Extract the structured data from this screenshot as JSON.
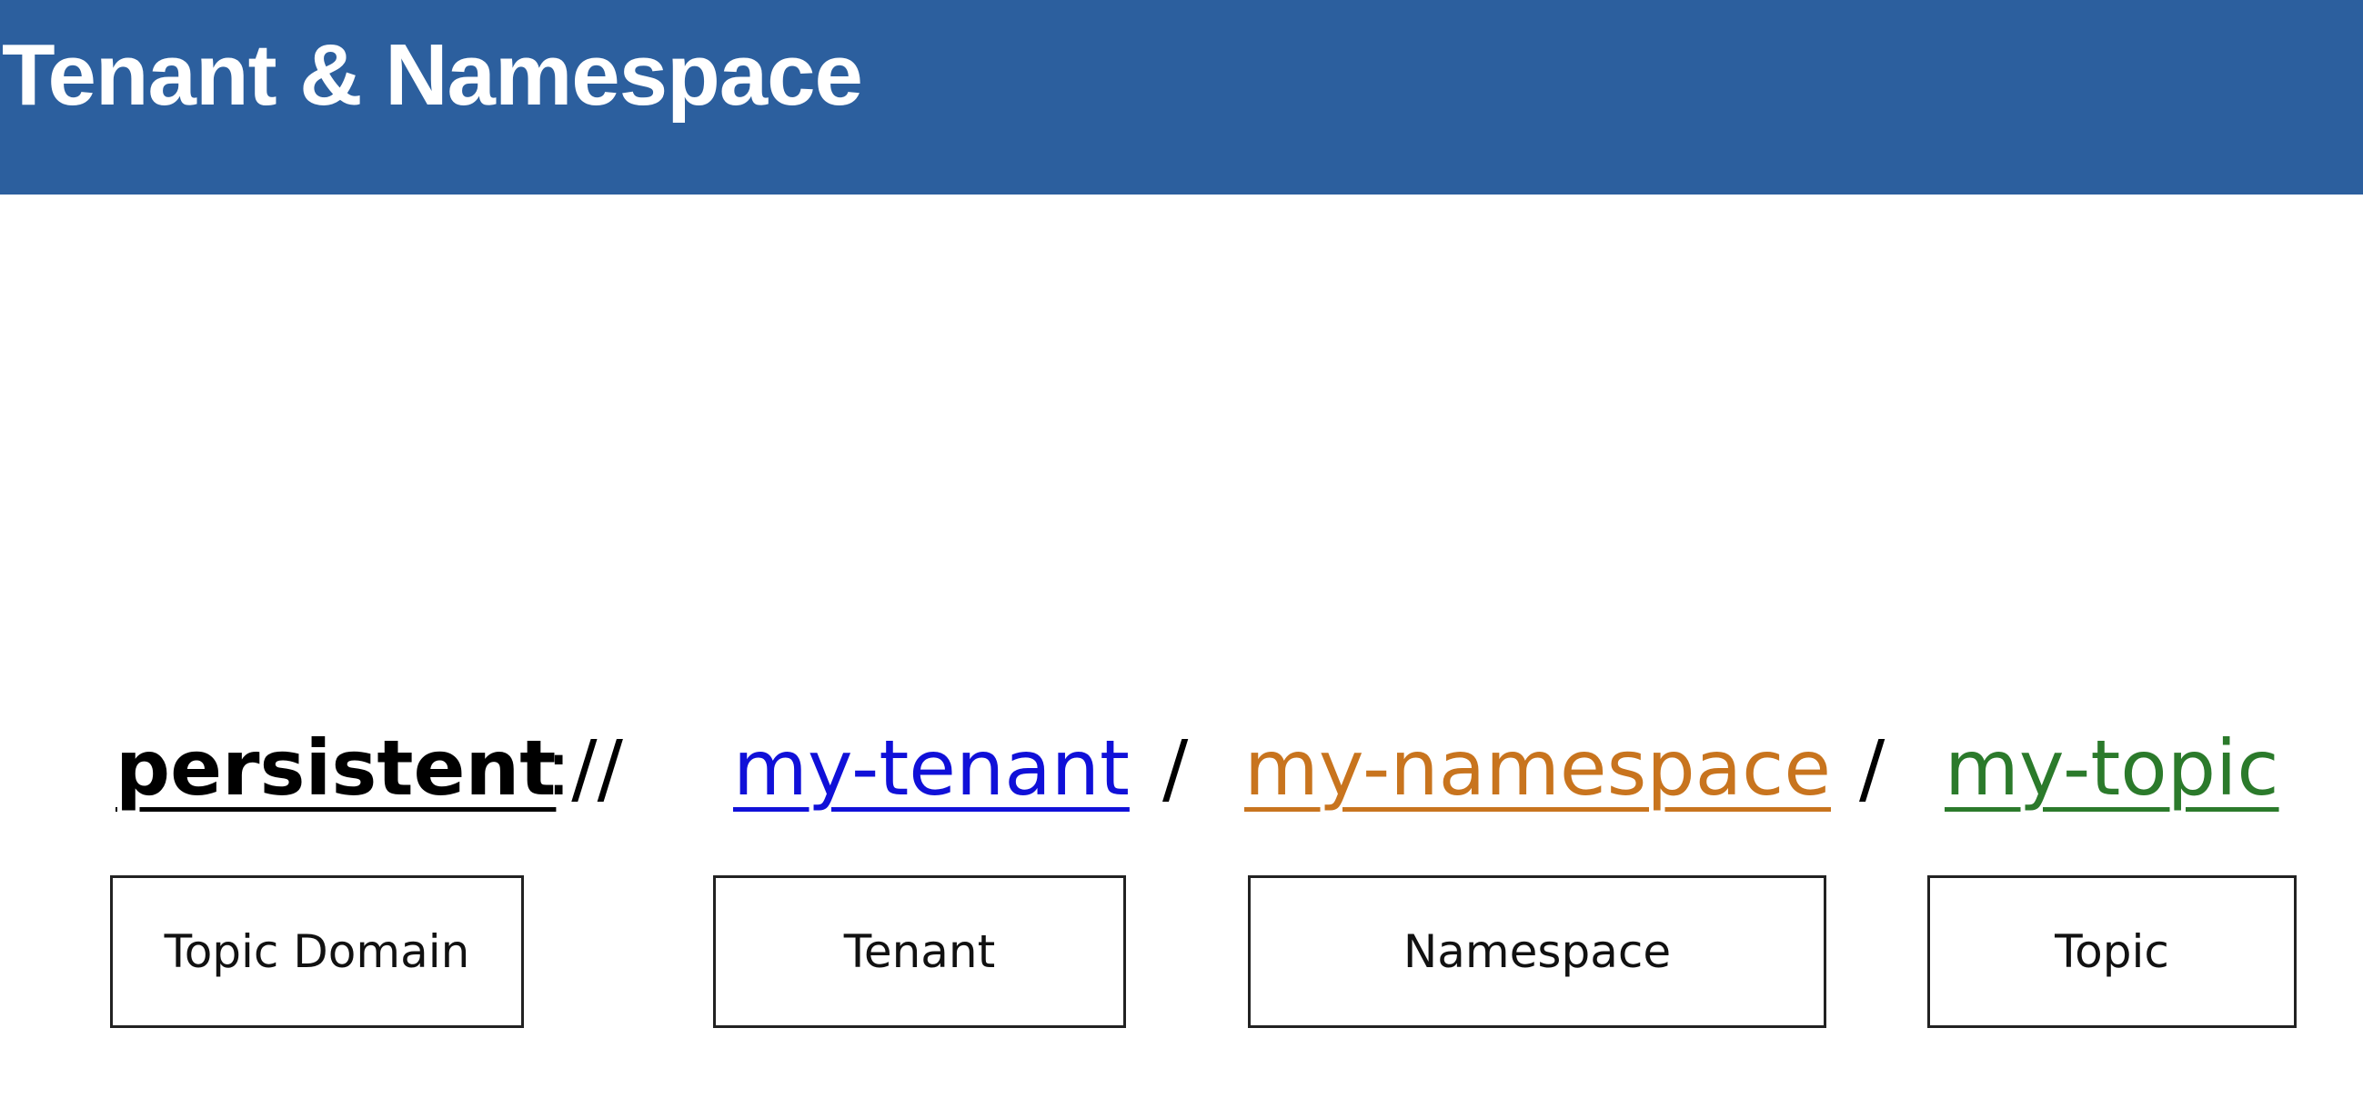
{
  "header": {
    "title": "Tenant & Namespace"
  },
  "topic_url": {
    "domain": {
      "text": "persistent",
      "color": "#000000"
    },
    "scheme_separator": "://",
    "tenant": {
      "text": "my-tenant",
      "color": "#1010d8"
    },
    "separator_1": "/",
    "namespace": {
      "text": "my-namespace",
      "color": "#c8741e"
    },
    "separator_2": "/",
    "topic": {
      "text": "my-topic",
      "color": "#2b7a2b"
    }
  },
  "labels": {
    "domain": "Topic Domain",
    "tenant": "Tenant",
    "namespace": "Namespace",
    "topic": "Topic"
  },
  "colors": {
    "header_background": "#2c5f9e",
    "header_text": "#ffffff"
  }
}
